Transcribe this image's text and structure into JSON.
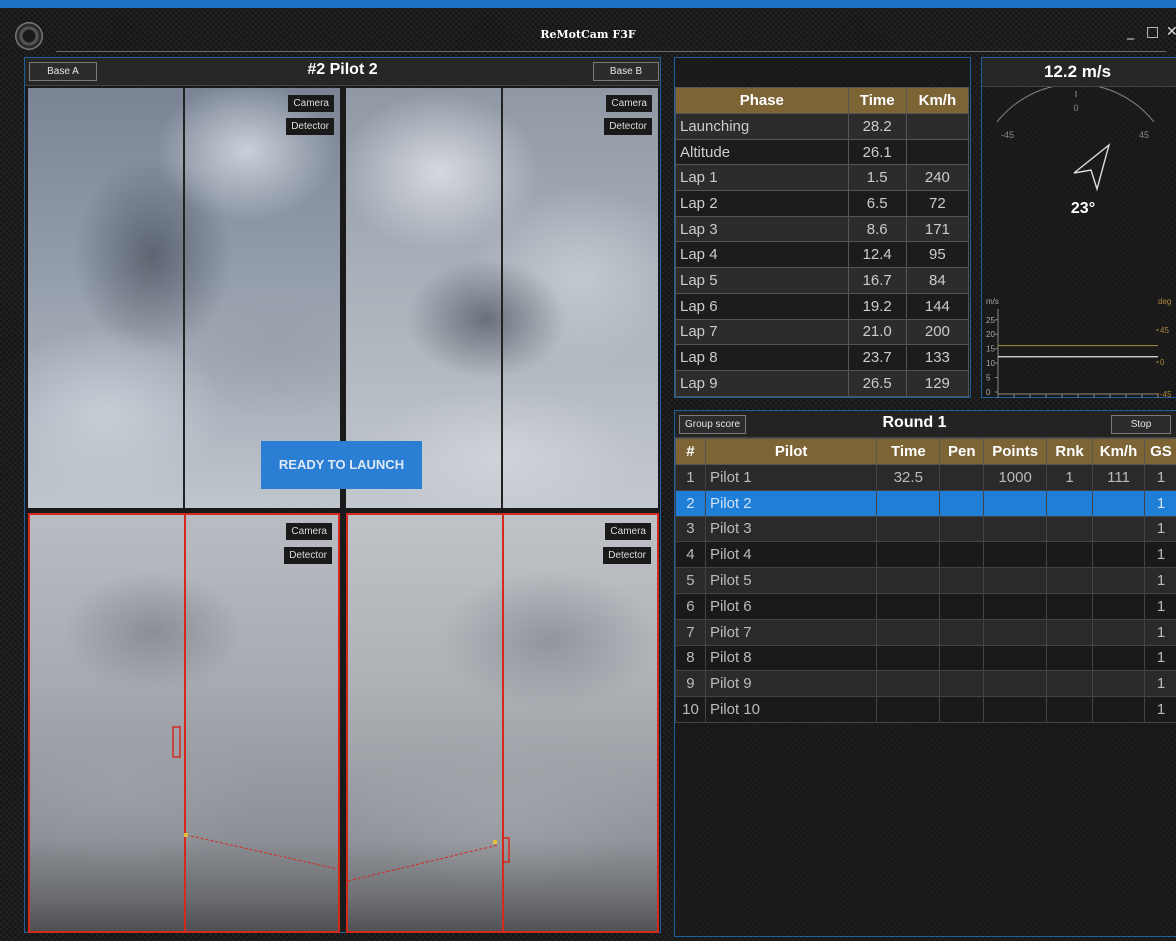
{
  "window": {
    "title": "ReMotCam F3F",
    "minimize": "_",
    "maximize": "□",
    "close": "✕"
  },
  "cameras": {
    "title": "#2 Pilot 2",
    "base_a_label": "Base A",
    "base_b_label": "Base B",
    "camera_label": "Camera",
    "detector_label": "Detector",
    "ready_label": "READY TO LAUNCH"
  },
  "phases": {
    "headers": [
      "Phase",
      "Time",
      "Km/h"
    ],
    "rows": [
      [
        "Launching",
        "28.2",
        ""
      ],
      [
        "Altitude",
        "26.1",
        ""
      ],
      [
        "Lap 1",
        "1.5",
        "240"
      ],
      [
        "Lap 2",
        "6.5",
        "72"
      ],
      [
        "Lap 3",
        "8.6",
        "171"
      ],
      [
        "Lap 4",
        "12.4",
        "95"
      ],
      [
        "Lap 5",
        "16.7",
        "84"
      ],
      [
        "Lap 6",
        "19.2",
        "144"
      ],
      [
        "Lap 7",
        "21.0",
        "200"
      ],
      [
        "Lap 8",
        "23.7",
        "133"
      ],
      [
        "Lap 9",
        "26.5",
        "129"
      ]
    ]
  },
  "wind": {
    "speed": "12.2 m/s",
    "direction": "23°",
    "gauge_labels": [
      "-45",
      "0",
      "45"
    ],
    "speed_unit": "m/s",
    "dir_unit": "deg",
    "speed_ticks": [
      "25",
      "20",
      "15",
      "10",
      "5",
      "0"
    ],
    "dir_ticks": [
      "45",
      "0",
      "-45"
    ],
    "direction_deg": 23,
    "speed_value": 12.2,
    "orange_color": "#b08a3e"
  },
  "round": {
    "title": "Round 1",
    "group_score_label": "Group score",
    "stop_label": "Stop",
    "headers": [
      "#",
      "Pilot",
      "Time",
      "Pen",
      "Points",
      "Rnk",
      "Km/h",
      "GS"
    ],
    "rows": [
      [
        "1",
        "Pilot 1",
        "32.5",
        "",
        "1000",
        "1",
        "111",
        "1"
      ],
      [
        "2",
        "Pilot 2",
        "",
        "",
        "",
        "",
        "",
        "1"
      ],
      [
        "3",
        "Pilot 3",
        "",
        "",
        "",
        "",
        "",
        "1"
      ],
      [
        "4",
        "Pilot 4",
        "",
        "",
        "",
        "",
        "",
        "1"
      ],
      [
        "5",
        "Pilot 5",
        "",
        "",
        "",
        "",
        "",
        "1"
      ],
      [
        "6",
        "Pilot 6",
        "",
        "",
        "",
        "",
        "",
        "1"
      ],
      [
        "7",
        "Pilot 7",
        "",
        "",
        "",
        "",
        "",
        "1"
      ],
      [
        "8",
        "Pilot 8",
        "",
        "",
        "",
        "",
        "",
        "1"
      ],
      [
        "9",
        "Pilot 9",
        "",
        "",
        "",
        "",
        "",
        "1"
      ],
      [
        "10",
        "Pilot 10",
        "",
        "",
        "",
        "",
        "",
        "1"
      ]
    ],
    "selected_index": 1
  },
  "colors": {
    "accent": "#1c73c8",
    "header_brown": "#7c6435",
    "selected_row": "#1f7fd6",
    "detector_red": "#d42a1e"
  }
}
